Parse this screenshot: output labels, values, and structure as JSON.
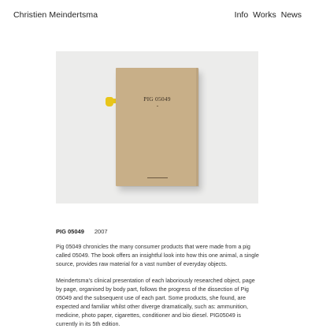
{
  "header": {
    "site_title": "Christien Meindertsma",
    "nav": [
      {
        "label": "Info"
      },
      {
        "label": "Works"
      },
      {
        "label": "News"
      }
    ]
  },
  "hero": {
    "book_cover_title": "PIG 05049"
  },
  "project": {
    "title": "PIG 05049",
    "year": "2007",
    "paragraphs": [
      "Pig 05049 chronicles the many consumer products that were made from a pig called 05049. The book offers an insightful look into how this one animal, a single source, provides raw material for a vast number of everyday objects.",
      "Meindertsma’s clinical presentation of each laboriously researched object, page by page, organised by body part, follows the progress of the dissection of Pig 05049 and the subsequent use of each part. Some products, she found, are expected and familiar whilst other diverge dramatically, such as: ammunition, medicine, photo paper, cigarettes, conditioner and bio diesel. PIG05049 is currently in its 5th edition."
    ]
  }
}
